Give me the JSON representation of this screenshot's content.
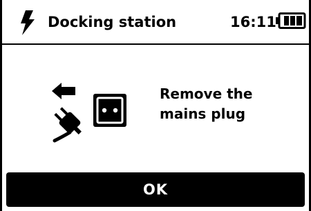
{
  "header": {
    "title": "Docking station",
    "time": "16:11",
    "left_icon": "lightning-bolt-icon",
    "battery_icon": "battery-icon"
  },
  "main": {
    "icon": "unplug-mains-icon",
    "message": "Remove the\nmains plug"
  },
  "footer": {
    "ok_label": "OK"
  },
  "colors": {
    "foreground": "#000000",
    "background": "#ffffff"
  }
}
